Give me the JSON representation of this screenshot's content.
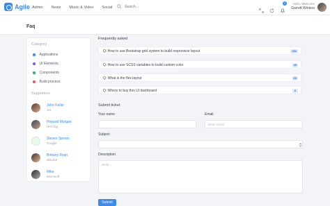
{
  "header": {
    "brand": "Agile",
    "nav": [
      "Admin",
      "News",
      "Music & Video",
      "Social"
    ],
    "search_placeholder": "Search...",
    "notification_count": "2",
    "user_greeting": "Hello, Welcome",
    "user_name": "Garrett Winters"
  },
  "page": {
    "title": "Faq"
  },
  "sidebar": {
    "category_heading": "Category",
    "categories": [
      {
        "label": "Applications",
        "color": "#3a8af0"
      },
      {
        "label": "UI Elements",
        "color": "#7c5ce6"
      },
      {
        "label": "Components",
        "color": "#2bb673"
      },
      {
        "label": "Build process",
        "color": "#f0506e"
      }
    ],
    "supporters_heading": "Supporters",
    "supporters": [
      {
        "name": "John Keller",
        "org": "Jet"
      },
      {
        "name": "Howard Morgan",
        "org": "HHH.bg"
      },
      {
        "name": "Steven Spears",
        "org": "Google"
      },
      {
        "name": "Brittany Ryan",
        "org": "BlackUI"
      },
      {
        "name": "Mike",
        "org": "Microsoft"
      }
    ]
  },
  "faq": {
    "heading": "Frequently asked",
    "items": [
      {
        "question": "Q: How to use Bootstrap grid system to build responsive layout",
        "count": "254"
      },
      {
        "question": "Q: How to use SCSS variables to build custom color",
        "count": "40"
      },
      {
        "question": "Q: What is the flex layout",
        "count": "60"
      },
      {
        "question": "Q: Where to buy this UI dashboard",
        "count": "6"
      }
    ]
  },
  "ticket": {
    "heading": "Submit ticket",
    "name_label": "Your name",
    "email_label": "Email",
    "email_placeholder": "Enter email",
    "subject_label": "Subject",
    "description_label": "Description",
    "description_placeholder": "Write...",
    "submit_label": "Submit"
  },
  "icons": {
    "search": "search-icon",
    "expand": "expand-icon",
    "refresh": "refresh-icon",
    "notification": "bell-icon",
    "select": "chevron-updown-icon"
  }
}
